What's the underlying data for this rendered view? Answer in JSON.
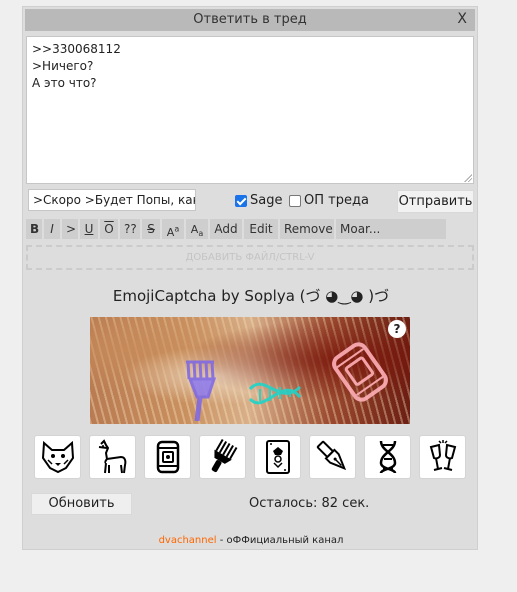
{
  "title": "Ответить в тред",
  "close_label": "X",
  "reply_lines": [
    ">>330068112",
    ">Ничего?",
    "А это что?"
  ],
  "subject_value": ">Скоро >Будет Попы, кака",
  "sage_label": "Sage",
  "sage_checked": true,
  "op_label": "ОП треда",
  "op_checked": false,
  "send_label": "Отправить",
  "toolbar": [
    "B",
    "I",
    ">",
    "U",
    "O",
    "??",
    "S",
    "A^a",
    "A_a",
    "Add",
    "Edit",
    "Remove",
    "Moar..."
  ],
  "attach_label": "ДОБАВИТЬ ФАЙЛ/CTRL-V",
  "captcha": {
    "title": "EmojiCaptcha by Soplya (づ ◕‿◕ )づ",
    "help": "?",
    "emojis": [
      "wolf-face-icon",
      "llama-icon",
      "food-can-icon",
      "afro-pick-icon",
      "joker-card-icon",
      "fountain-pen-icon",
      "dna-icon",
      "champagne-glasses-icon"
    ],
    "refresh_label": "Обновить",
    "remaining_label": "Осталось: 82 сек."
  },
  "footer": {
    "link": "dvachannel",
    "text": " - оФФициальный канал"
  },
  "colors": {
    "link": "#ff6600",
    "checkbox": "#1a73e8",
    "titlebar": "#b9b9b9"
  }
}
